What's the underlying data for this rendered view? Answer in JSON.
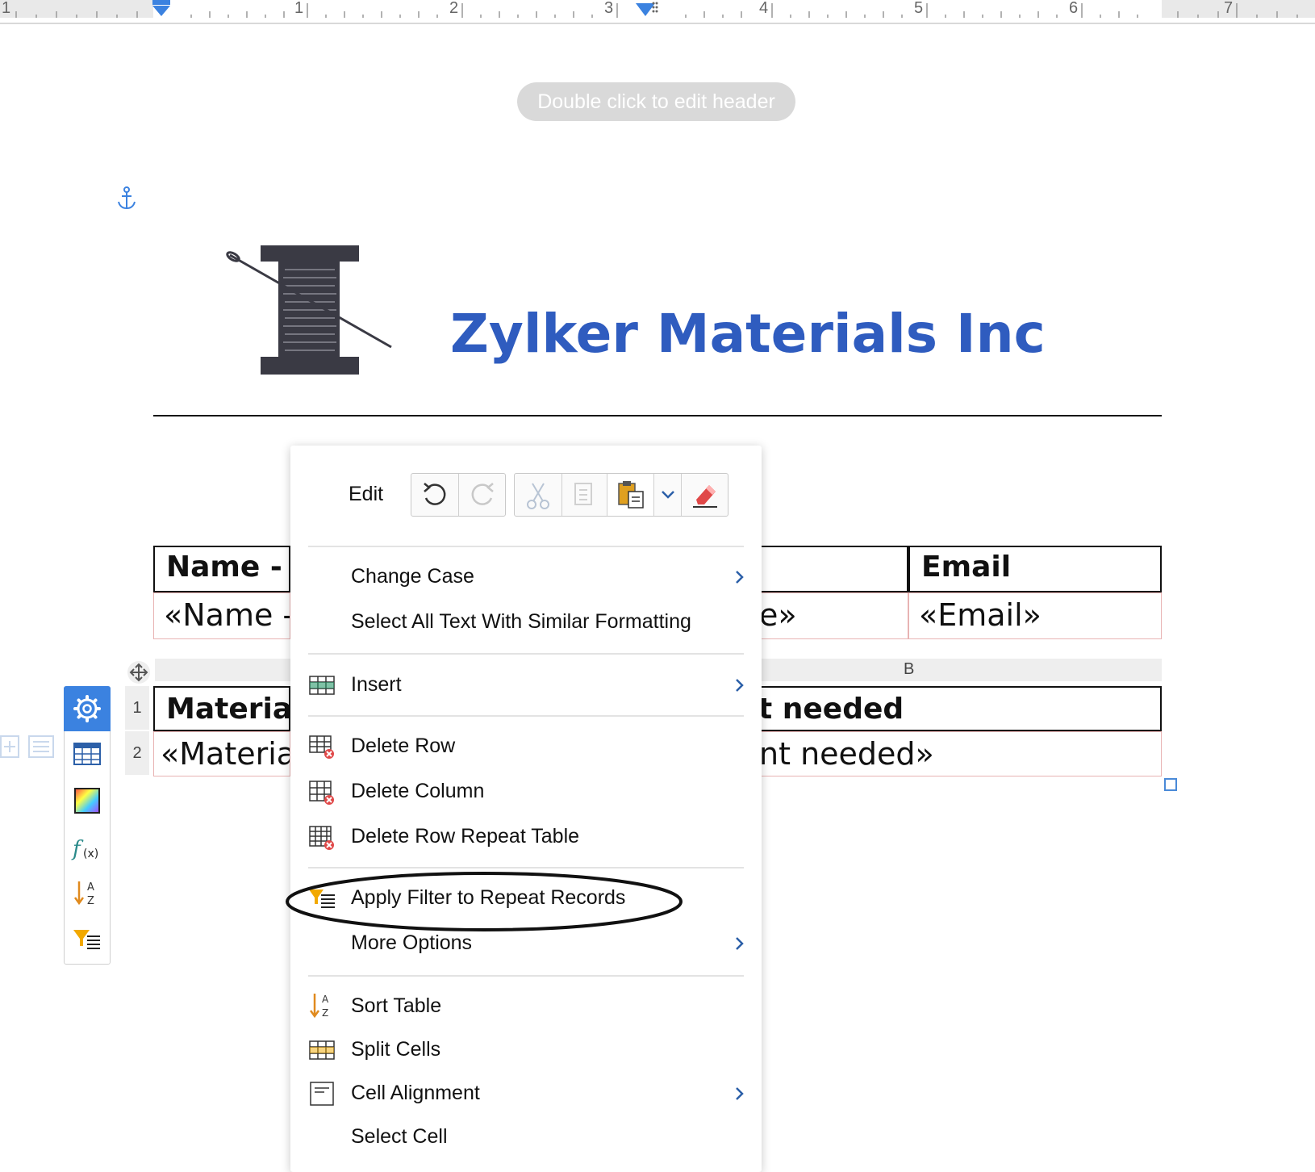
{
  "ruler": {
    "numbers": [
      "1",
      "1",
      "2",
      "3",
      "4",
      "5",
      "6",
      "7"
    ]
  },
  "header_hint": "Double click to edit header",
  "document": {
    "company_name": "Zylker Materials Inc",
    "table1": {
      "headers": [
        "Name - F",
        "Email"
      ],
      "values": [
        "«Name -",
        "e»",
        "«Email»"
      ]
    },
    "table2": {
      "column_label": "B",
      "row_numbers": [
        "1",
        "2"
      ],
      "headers": [
        "Material",
        "t needed"
      ],
      "values": [
        "«Material",
        "nt needed»"
      ]
    }
  },
  "side_toolbar": {
    "icons": [
      "gear-icon",
      "table-icon",
      "color-fill-icon",
      "formula-icon",
      "sort-icon",
      "filter-icon"
    ]
  },
  "context_menu": {
    "edit_label": "Edit",
    "items": {
      "change_case": "Change Case",
      "select_similar": "Select All Text With Similar Formatting",
      "insert": "Insert",
      "delete_row": "Delete Row",
      "delete_column": "Delete Column",
      "delete_repeat_table": "Delete Row Repeat Table",
      "apply_filter": "Apply Filter to Repeat Records",
      "more_options": "More Options",
      "sort_table": "Sort Table",
      "split_cells": "Split Cells",
      "cell_alignment": "Cell Alignment",
      "select_cell": "Select Cell"
    }
  },
  "colors": {
    "brand_blue": "#2f5cbf",
    "accent_blue": "#3b82e0",
    "filter_orange": "#f2a900"
  }
}
